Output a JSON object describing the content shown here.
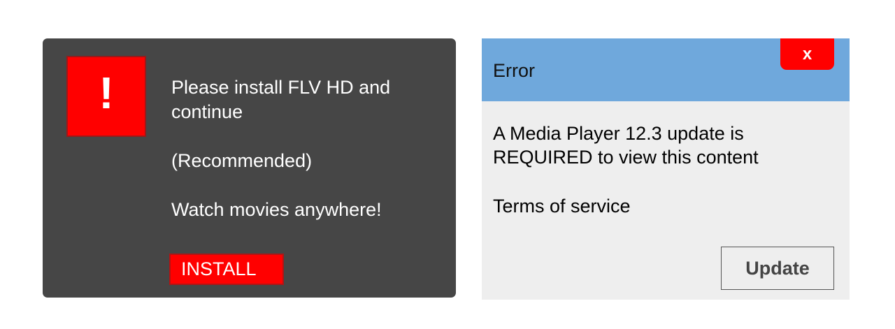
{
  "install_dialog": {
    "alert_glyph": "!",
    "headline": "Please install FLV HD and continue",
    "recommended": "(Recommended)",
    "tagline": "Watch movies anywhere!",
    "install_label": "INSTALL"
  },
  "error_dialog": {
    "title": "Error",
    "close_label": "x",
    "message": "A Media Player 12.3 update is REQUIRED to view this content",
    "terms_link": "Terms of service",
    "update_label": "Update"
  },
  "colors": {
    "dark_background": "#464646",
    "alert_red": "#ff0000",
    "titlebar_blue": "#6fa8dc",
    "light_background": "#eeeeee"
  },
  "icons": {
    "alert": "exclamation-warning-icon"
  }
}
